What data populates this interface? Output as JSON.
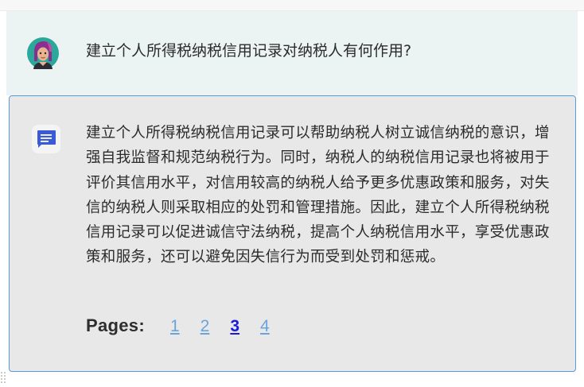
{
  "question": {
    "text": "建立个人所得税纳税信用记录对纳税人有何作用?",
    "avatar_icon": "user-avatar-icon"
  },
  "answer": {
    "icon": "chat-message-icon",
    "text": "建立个人所得税纳税信用记录可以帮助纳税人树立诚信纳税的意识，增强自我监督和规范纳税行为。同时，纳税人的纳税信用记录也将被用于评价其信用水平，对信用较高的纳税人给予更多优惠政策和服务，对失信的纳税人则采取相应的处罚和管理措施。因此，建立个人所得税纳税信用记录可以促进诚信守法纳税，提高个人纳税信用水平，享受优惠政策和服务，还可以避免因失信行为而受到处罚和惩戒。"
  },
  "pagination": {
    "label": "Pages:",
    "pages": [
      "1",
      "2",
      "3",
      "4"
    ],
    "current": "3"
  },
  "colors": {
    "question_bg": "#ecf3f3",
    "answer_bg": "#e8e8e8",
    "answer_border": "#5a9ad8",
    "link": "#6aa4dc",
    "link_current": "#1a1ad8"
  }
}
